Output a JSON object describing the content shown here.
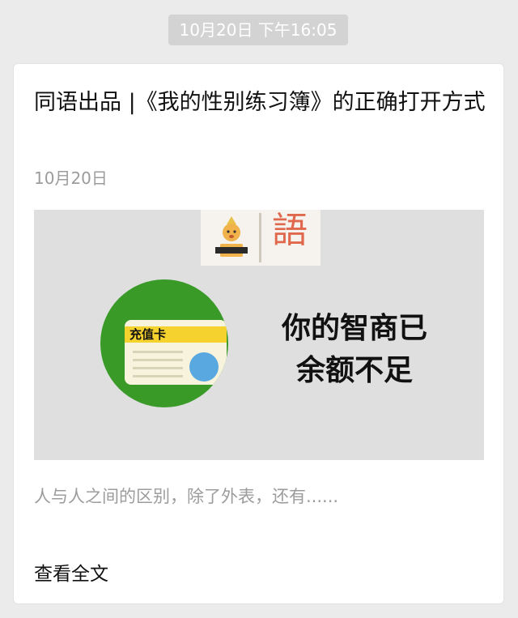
{
  "timestamp": "10月20日 下午16:05",
  "article": {
    "title": "同语出品 |《我的性别练习簿》的正确打开方式",
    "date": "10月20日",
    "summary": "人与人之间的区别，除了外表，还有......",
    "read_more": "查看全文"
  },
  "cover": {
    "card_label": "充值卡",
    "headline_line1": "你的智商已",
    "headline_line2": "余额不足",
    "logo_char": "語"
  },
  "colors": {
    "background": "#ebebeb",
    "card": "#ffffff",
    "green": "#3a9a28",
    "stripe": "#f5d22e",
    "logo_red": "#e0684d"
  }
}
